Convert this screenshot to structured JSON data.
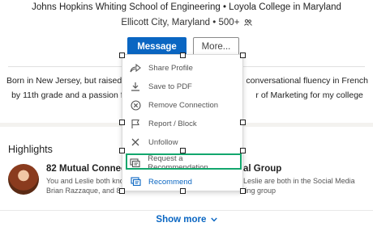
{
  "profile": {
    "education": "Johns Hopkins Whiting School of Engineering • Loyola College in Maryland",
    "location": "Ellicott City, Maryland",
    "connections": "500+",
    "message_label": "Message",
    "more_label": "More...",
    "about_line1": "Born in New Jersey, but raised i",
    "about_line1_end": "conversational fluency in French",
    "about_line2": "by 11th grade and a passion for r",
    "about_line2_end": "r of Marketing for my college ye..."
  },
  "menu": {
    "items": [
      {
        "label": "Share Profile",
        "icon": "share-icon"
      },
      {
        "label": "Save to PDF",
        "icon": "download-icon"
      },
      {
        "label": "Remove Connection",
        "icon": "remove-connection-icon"
      },
      {
        "label": "Report / Block",
        "icon": "flag-icon"
      },
      {
        "label": "Unfollow",
        "icon": "x-icon"
      },
      {
        "label": "Request a Recommendation",
        "icon": "recommendation-icon"
      },
      {
        "label": "Recommend",
        "icon": "recommend-icon"
      }
    ]
  },
  "highlights": {
    "title": "Highlights",
    "mutual_title": "82 Mutual Connecti",
    "mutual_desc_line1": "You and Leslie both kno",
    "mutual_desc_line2": "Brian Razzaque, and 80",
    "group_title": "al Group",
    "group_desc_line1": "Leslie are both in the Social Media",
    "group_desc_line2": "ting group",
    "show_more": "Show more"
  },
  "colors": {
    "accent": "#0a66c2",
    "highlight_box": "#13a66d"
  }
}
